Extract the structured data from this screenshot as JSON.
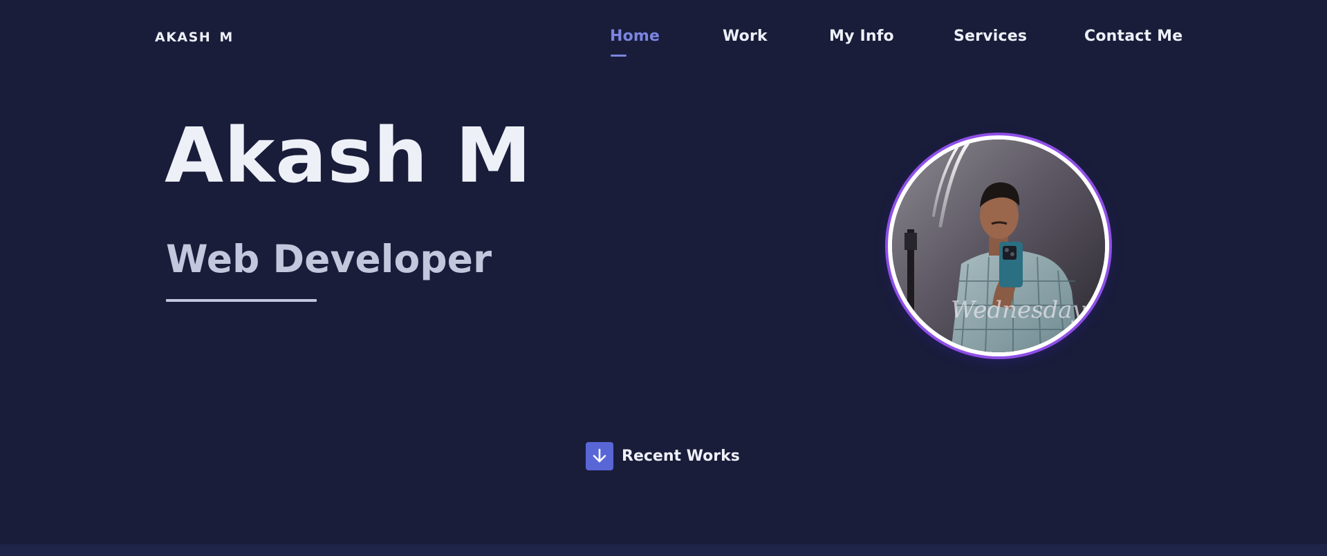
{
  "brand": {
    "logo_text": "AKASH M"
  },
  "nav": {
    "items": [
      {
        "label": "Home",
        "active": true
      },
      {
        "label": "Work",
        "active": false
      },
      {
        "label": "My Info",
        "active": false
      },
      {
        "label": "Services",
        "active": false
      },
      {
        "label": "Contact Me",
        "active": false
      }
    ]
  },
  "hero": {
    "name": "Akash M",
    "role": "Web Developer"
  },
  "avatar": {
    "icon": "profile-photo",
    "watermark_text": "Wednesday"
  },
  "cta": {
    "label": "Recent Works",
    "icon": "arrow-down-icon"
  },
  "colors": {
    "background": "#191d3a",
    "accent": "#7b85e0",
    "button_bg": "#5966d6",
    "ring": "#8f4fe6"
  }
}
